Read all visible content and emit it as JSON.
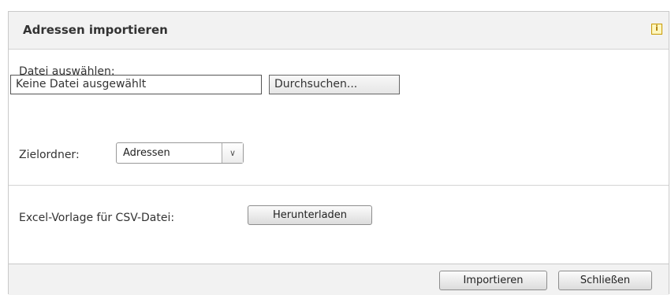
{
  "dialog": {
    "title": "Adressen importieren",
    "info_icon": "info-icon",
    "info_glyph": "i"
  },
  "file": {
    "label": "Datei auswählen:",
    "value": "Keine Datei ausgewählt",
    "browse_label": "Durchsuchen..."
  },
  "folder": {
    "label": "Zielordner:",
    "selected": "Adressen",
    "arrow_glyph": "∨"
  },
  "template": {
    "label": "Excel-Vorlage für CSV-Datei:",
    "download_label": "Herunterladen"
  },
  "footer": {
    "import_label": "Importieren",
    "close_label": "Schließen"
  }
}
